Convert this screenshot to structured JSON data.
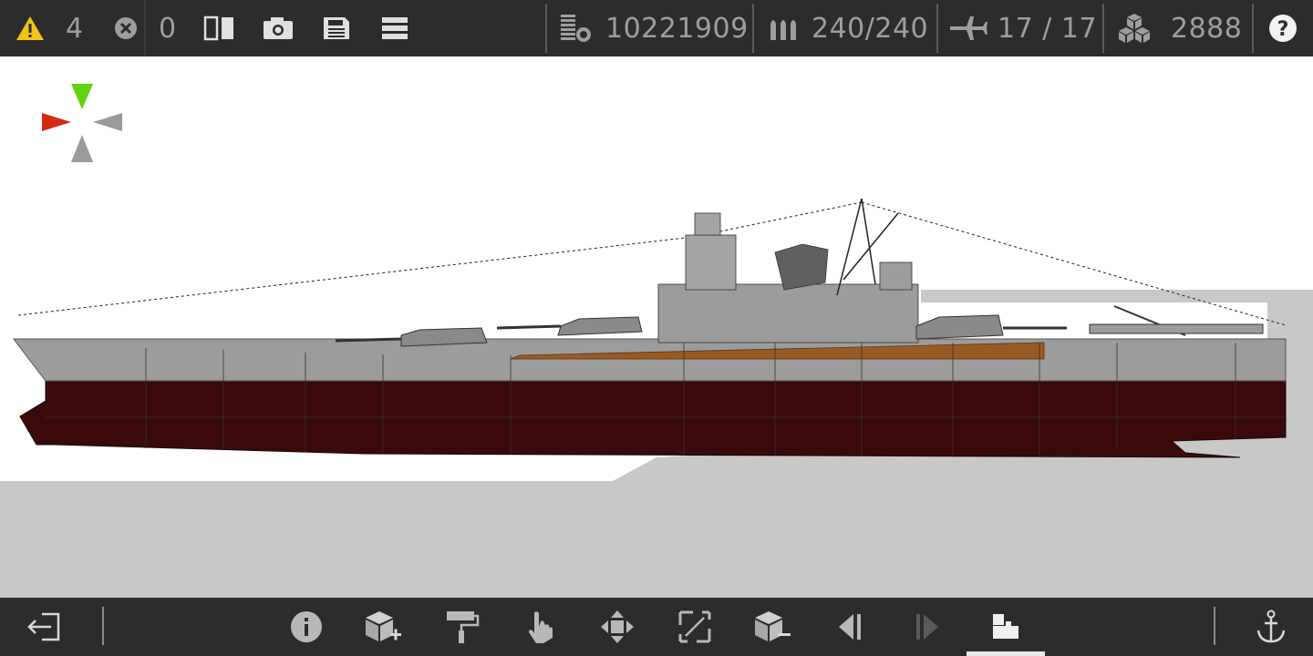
{
  "topbar": {
    "warnings": {
      "icon": "warning-icon",
      "count": "4",
      "color": "#f0c419"
    },
    "errors": {
      "icon": "error-icon",
      "count": "0"
    },
    "tools": [
      {
        "name": "mirror-icon"
      },
      {
        "name": "camera-icon"
      },
      {
        "name": "save-icon"
      },
      {
        "name": "menu-icon"
      }
    ],
    "stats": {
      "cost": {
        "icon": "cost-icon",
        "value": "10221909"
      },
      "ammo": {
        "icon": "ammo-icon",
        "value": "240/240"
      },
      "aircraft": {
        "icon": "aircraft-icon",
        "value": "17 / 17"
      },
      "parts": {
        "icon": "parts-icon",
        "value": "2888"
      }
    },
    "help": {
      "icon": "help-icon"
    }
  },
  "viewport": {
    "axis_gizmo": {
      "colors": {
        "y": "#5fd312",
        "x": "#d42a14",
        "neutral": "#9a9a9a"
      }
    },
    "ship": {
      "hull_color": "#3a0a0a",
      "upper_hull_color": "#9c9c9c",
      "deck_color": "#9a5a24"
    },
    "ground_color": "#c8c8c8"
  },
  "bottombar": {
    "buttons": [
      {
        "name": "exit-icon"
      },
      {
        "name": "info-icon"
      },
      {
        "name": "add-block-icon"
      },
      {
        "name": "paint-icon"
      },
      {
        "name": "select-icon"
      },
      {
        "name": "move-icon"
      },
      {
        "name": "resize-icon"
      },
      {
        "name": "remove-block-icon"
      },
      {
        "name": "undo-icon"
      },
      {
        "name": "redo-icon"
      },
      {
        "name": "dock-icon"
      },
      {
        "name": "anchor-icon"
      }
    ],
    "active": "dock-icon"
  }
}
